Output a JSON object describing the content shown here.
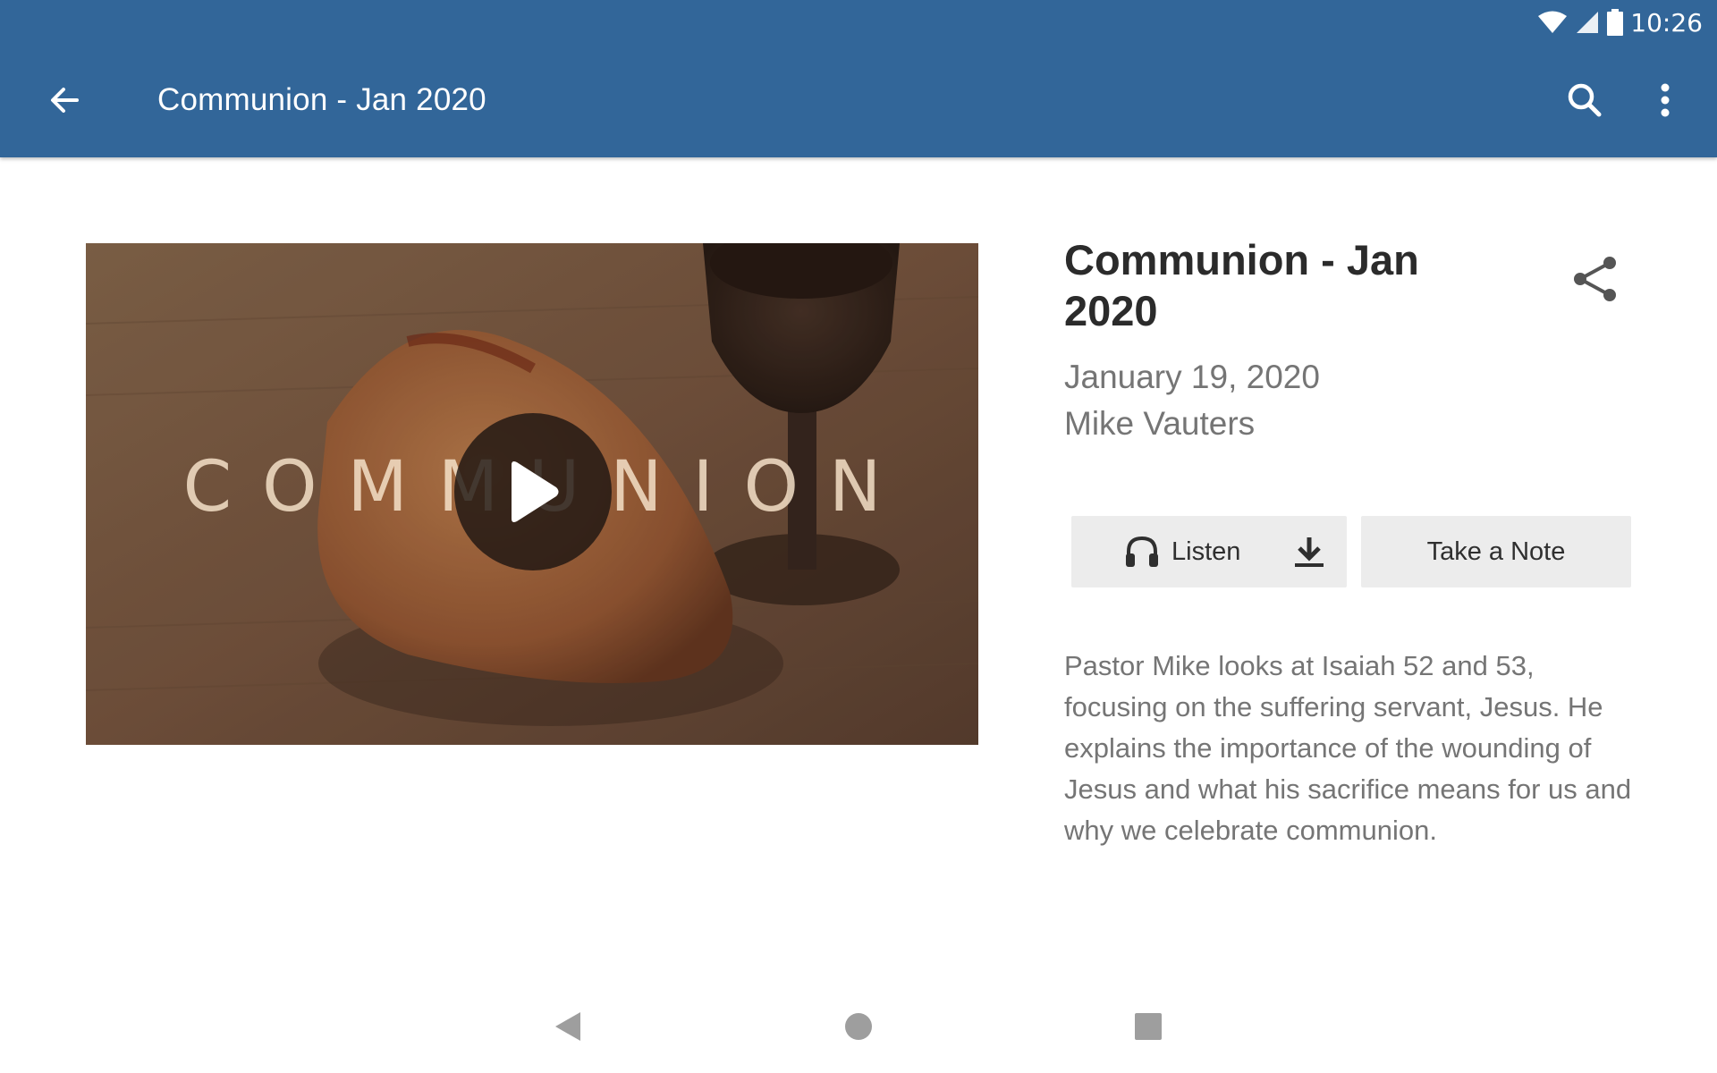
{
  "status_bar": {
    "time": "10:26"
  },
  "app_bar": {
    "title": "Communion - Jan 2020"
  },
  "media": {
    "overlay_text": "COMMUNION"
  },
  "sermon": {
    "title": "Communion - Jan 2020",
    "date": "January 19, 2020",
    "speaker": "Mike Vauters",
    "description": "Pastor Mike looks at Isaiah 52 and 53, focusing on the suffering servant, Jesus. He explains the importance of the wounding of Jesus and what his sacrifice means for us and why we celebrate communion."
  },
  "actions": {
    "listen_label": "Listen",
    "note_label": "Take a Note"
  },
  "icons": {
    "back": "arrow-left-icon",
    "search": "search-icon",
    "more": "more-vert-icon",
    "share": "share-icon",
    "listen": "headphones-icon",
    "download": "download-icon",
    "play": "play-icon"
  },
  "colors": {
    "app_bar": "#326699",
    "button_bg": "#ececec",
    "secondary_text": "#757575"
  }
}
